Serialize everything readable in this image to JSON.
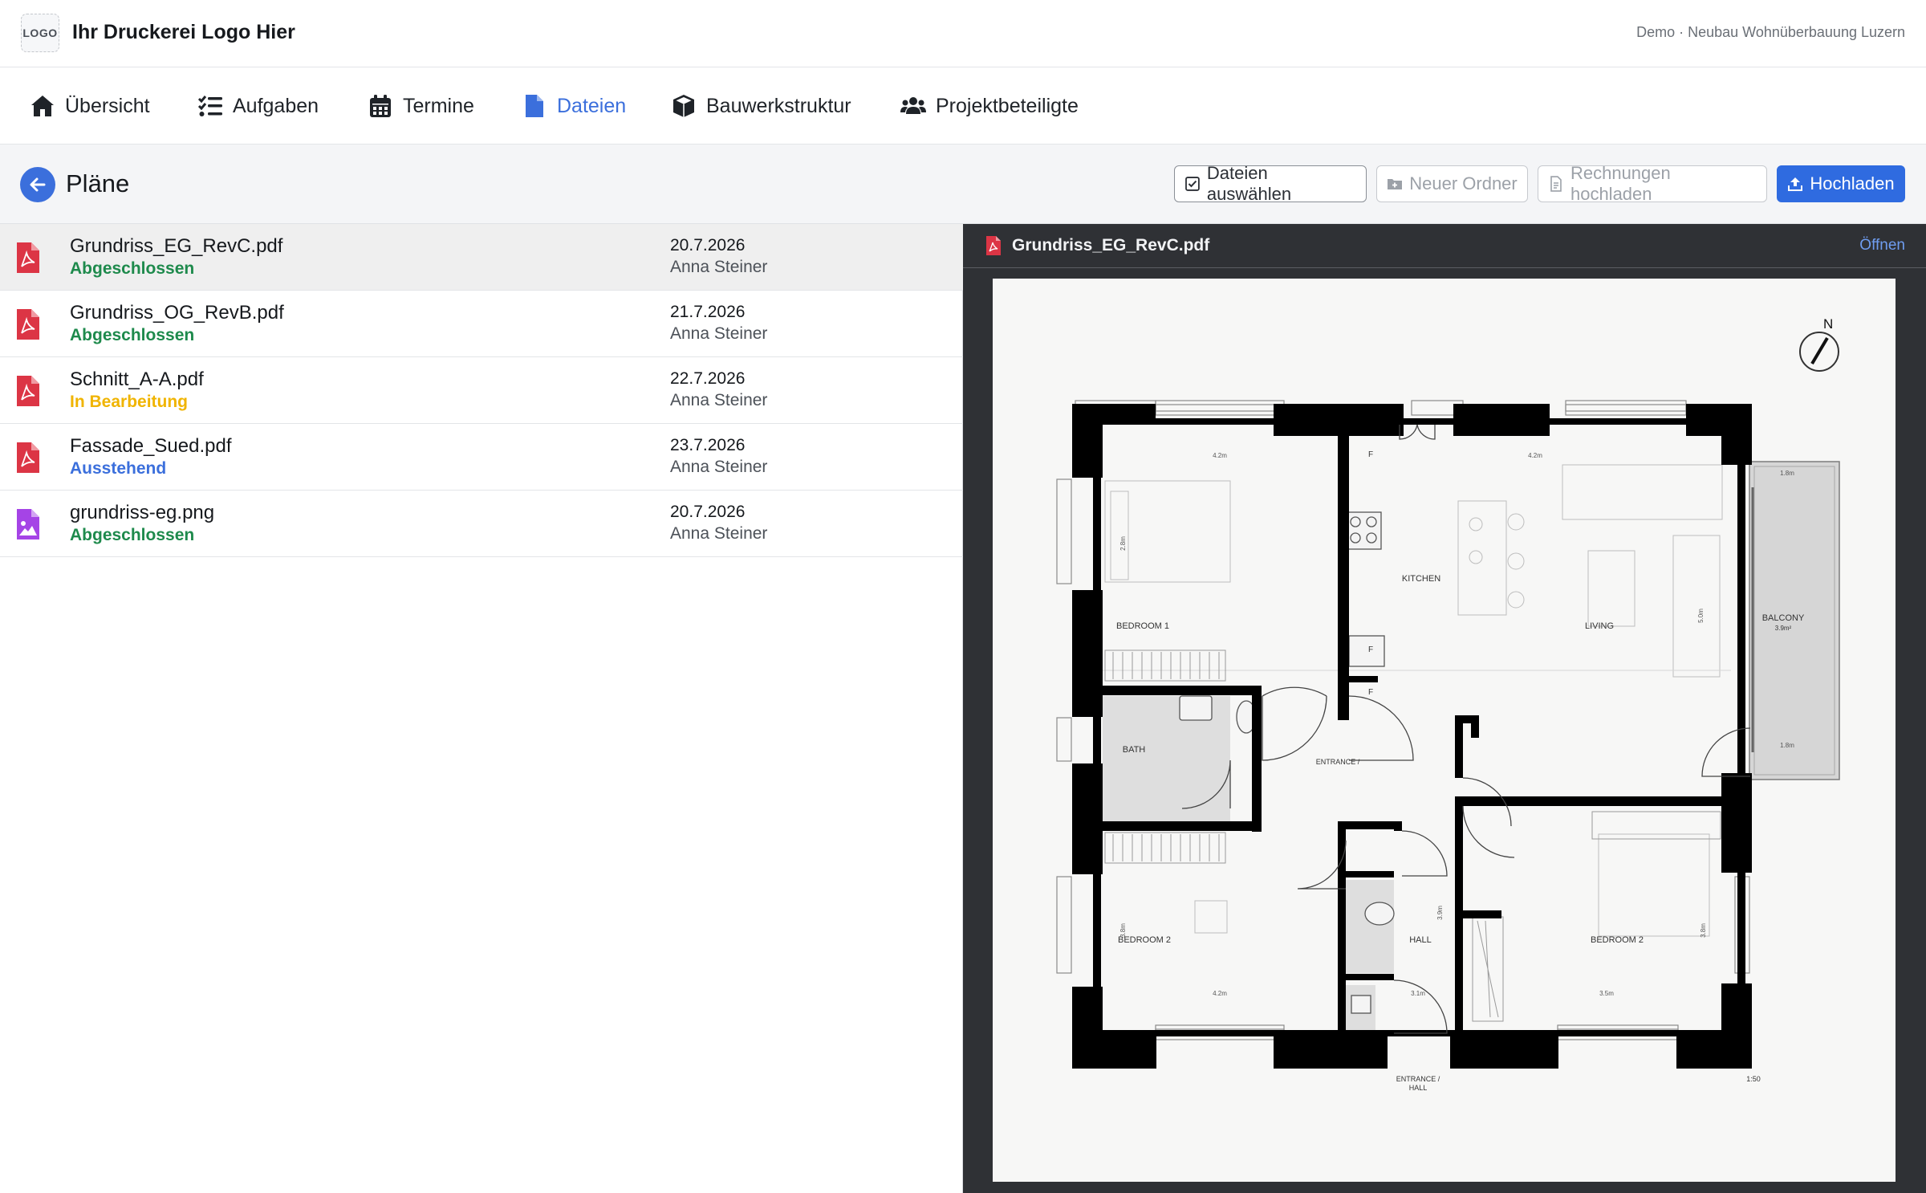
{
  "header": {
    "logo_text": "LOGO",
    "brand": "Ihr Druckerei Logo Hier",
    "project": "Demo · Neubau Wohnüberbauung Luzern"
  },
  "nav": {
    "items": [
      {
        "label": "Übersicht",
        "icon": "home-icon"
      },
      {
        "label": "Aufgaben",
        "icon": "tasks-icon"
      },
      {
        "label": "Termine",
        "icon": "calendar-icon"
      },
      {
        "label": "Dateien",
        "icon": "file-icon",
        "active": true
      },
      {
        "label": "Bauwerkstruktur",
        "icon": "cube-icon"
      },
      {
        "label": "Projektbeteiligte",
        "icon": "users-icon"
      }
    ],
    "active_color": "#3b6fdc"
  },
  "page": {
    "title": "Pläne",
    "buttons": {
      "select": "Dateien auswählen",
      "new_folder": "Neuer Ordner",
      "invoices": "Rechnungen hochladen",
      "upload": "Hochladen"
    }
  },
  "files": [
    {
      "name": "Grundriss_EG_RevC.pdf",
      "status": "Abgeschlossen",
      "status_color": "#1e8a4c",
      "date": "20.7.2026",
      "author": "Anna Steiner",
      "type": "pdf"
    },
    {
      "name": "Grundriss_OG_RevB.pdf",
      "status": "Abgeschlossen",
      "status_color": "#1e8a4c",
      "date": "21.7.2026",
      "author": "Anna Steiner",
      "type": "pdf"
    },
    {
      "name": "Schnitt_A-A.pdf",
      "status": "In Bearbeitung",
      "status_color": "#f0b400",
      "date": "22.7.2026",
      "author": "Anna Steiner",
      "type": "pdf"
    },
    {
      "name": "Fassade_Sued.pdf",
      "status": "Ausstehend",
      "status_color": "#3b6fdc",
      "date": "23.7.2026",
      "author": "Anna Steiner",
      "type": "pdf"
    },
    {
      "name": "grundriss-eg.png",
      "status": "Abgeschlossen",
      "status_color": "#1e8a4c",
      "date": "20.7.2026",
      "author": "Anna Steiner",
      "type": "image"
    }
  ],
  "preview": {
    "filename": "Grundriss_EG_RevC.pdf",
    "open_label": "Öffnen",
    "plan_labels": {
      "north": "N",
      "kitchen": "KITCHEN",
      "living": "LIVING",
      "bedroom1": "BEDROOM 1",
      "bath": "BATH",
      "entrance": "ENTRANCE /",
      "balcony": "BALCONY",
      "balcony_area": "3.9m²",
      "bedroom2_left": "BEDROOM 2",
      "hall": "HALL",
      "bedroom2_right": "BEDROOM 2",
      "entrance_hall_1": "ENTRANCE /",
      "entrance_hall_2": "HALL",
      "scale": "1:50",
      "fridge": "F",
      "dim_4_2m": "4.2m",
      "dim_3_1m": "3.1m",
      "dim_3_5m": "3.5m",
      "dim_1_8m": "1.8m",
      "dim_2_8m": "2.8m",
      "dim_5_0m": "5.0m",
      "dim_3_8m": "3.8m",
      "dim_3_9m": "3.9m"
    }
  },
  "colors": {
    "pdf_icon": "#dc3545",
    "image_icon": "#a544e6",
    "primary": "#2f6be0"
  }
}
